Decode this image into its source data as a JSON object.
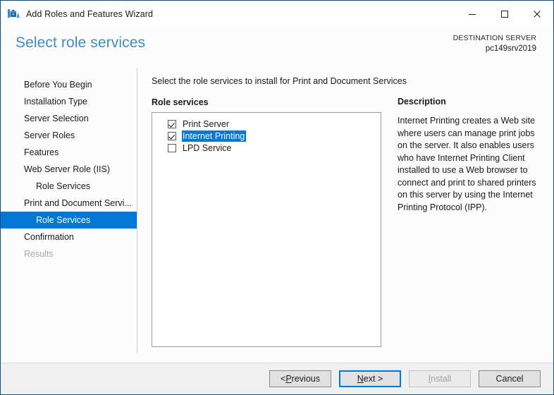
{
  "window": {
    "title": "Add Roles and Features Wizard",
    "icon": "wizard-toolbox-icon",
    "minimize": "—",
    "maximize": "□",
    "close": "✕"
  },
  "header": {
    "page_title": "Select role services",
    "destination_label": "DESTINATION SERVER",
    "destination_server": "pc149srv2019"
  },
  "nav": {
    "items": [
      {
        "label": "Before You Begin",
        "level": 0,
        "state": "normal"
      },
      {
        "label": "Installation Type",
        "level": 0,
        "state": "normal"
      },
      {
        "label": "Server Selection",
        "level": 0,
        "state": "normal"
      },
      {
        "label": "Server Roles",
        "level": 0,
        "state": "normal"
      },
      {
        "label": "Features",
        "level": 0,
        "state": "normal"
      },
      {
        "label": "Web Server Role (IIS)",
        "level": 0,
        "state": "normal"
      },
      {
        "label": "Role Services",
        "level": 1,
        "state": "normal"
      },
      {
        "label": "Print and Document Servi...",
        "level": 0,
        "state": "normal"
      },
      {
        "label": "Role Services",
        "level": 1,
        "state": "selected"
      },
      {
        "label": "Confirmation",
        "level": 0,
        "state": "normal"
      },
      {
        "label": "Results",
        "level": 0,
        "state": "disabled"
      }
    ]
  },
  "main": {
    "instruction": "Select the role services to install for Print and Document Services",
    "section_label": "Role services",
    "role_services": [
      {
        "label": "Print Server",
        "checked": true,
        "selected": false
      },
      {
        "label": "Internet Printing",
        "checked": true,
        "selected": true
      },
      {
        "label": "LPD Service",
        "checked": false,
        "selected": false
      }
    ]
  },
  "description": {
    "title": "Description",
    "text": "Internet Printing creates a Web site where users can manage print jobs on the server. It also enables users who have Internet Printing Client installed to use a Web browser to connect and print to shared printers on this server by using the Internet Printing Protocol (IPP)."
  },
  "footer": {
    "buttons": [
      {
        "label": "< Previous",
        "accel": "P",
        "state": "normal"
      },
      {
        "label": "Next >",
        "accel": "N",
        "state": "focused"
      },
      {
        "label": "Install",
        "accel": "I",
        "state": "disabled"
      },
      {
        "label": "Cancel",
        "accel": "",
        "state": "normal"
      }
    ]
  },
  "colors": {
    "accent": "#0078d4",
    "title_blue": "#3d8dc4",
    "window_border": "#0f4d7d"
  }
}
